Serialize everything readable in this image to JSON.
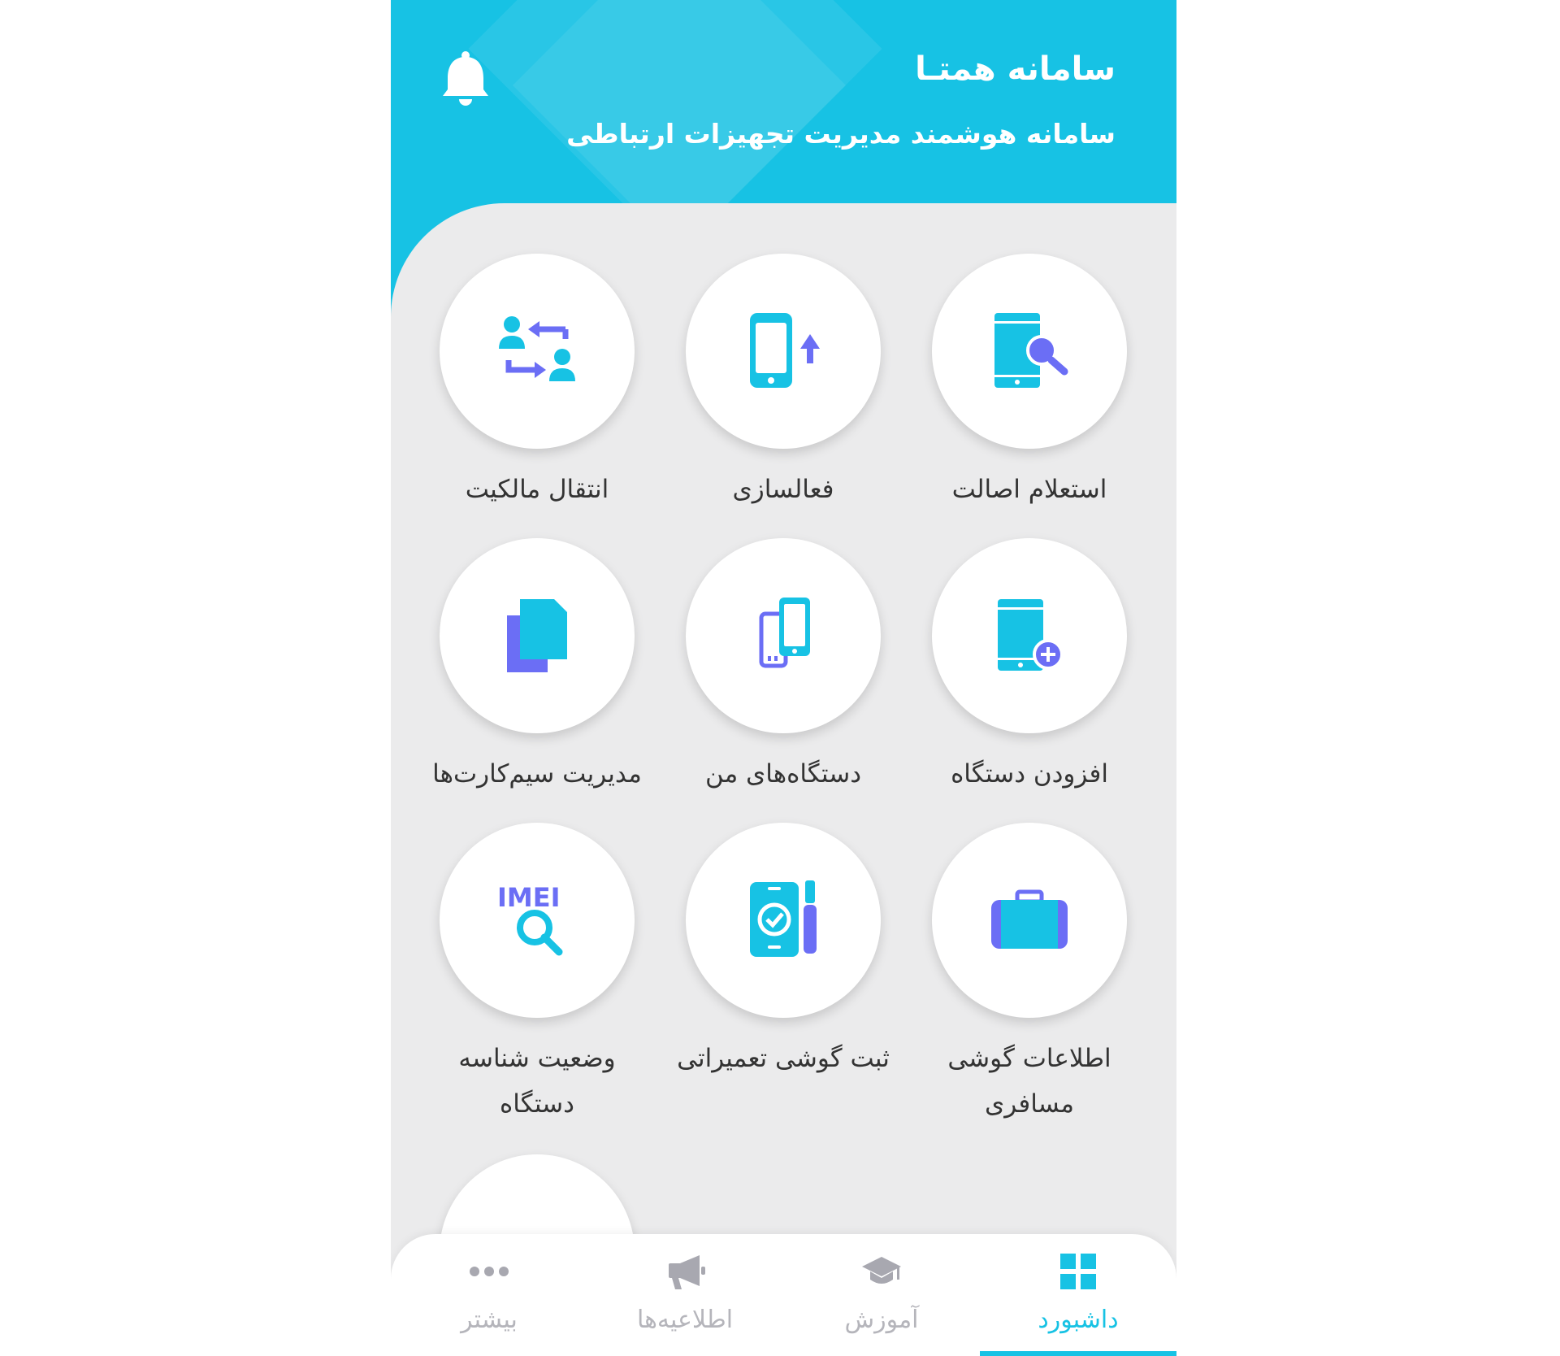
{
  "header": {
    "title": "سامانه همتـا",
    "subtitle": "سامانه هوشمند مدیریت تجهیزات ارتباطی"
  },
  "services": [
    {
      "label": "استعلام اصالت",
      "icon": "phone-search-icon"
    },
    {
      "label": "فعالسازی",
      "icon": "phone-upload-icon"
    },
    {
      "label": "انتقال مالکیت",
      "icon": "ownership-transfer-icon"
    },
    {
      "label": "افزودن دستگاه",
      "icon": "add-device-icon"
    },
    {
      "label": "دستگاه‌های من",
      "icon": "my-devices-icon"
    },
    {
      "label": "مدیریت سیم‌کارت‌ها",
      "icon": "sim-cards-icon"
    },
    {
      "label_line1": "اطلاعات گوشی",
      "label_line2": "مسافری",
      "icon": "suitcase-icon"
    },
    {
      "label": "ثبت گوشی تعمیراتی",
      "icon": "repair-phone-icon"
    },
    {
      "label_line1": "وضعیت شناسه",
      "label_line2": "دستگاه",
      "icon": "imei-search-icon",
      "imei_text": "IMEI"
    },
    {
      "icon": "delivery-truck-icon"
    }
  ],
  "nav": {
    "dashboard": "داشبورد",
    "education": "آموزش",
    "announcements": "اطلاعیه‌ها",
    "more": "بیشتر",
    "active": "dashboard"
  },
  "colors": {
    "primary": "#17c2e4",
    "accent": "#6b6ef5",
    "background": "#ebebec",
    "inactive": "#b5b5bb"
  }
}
